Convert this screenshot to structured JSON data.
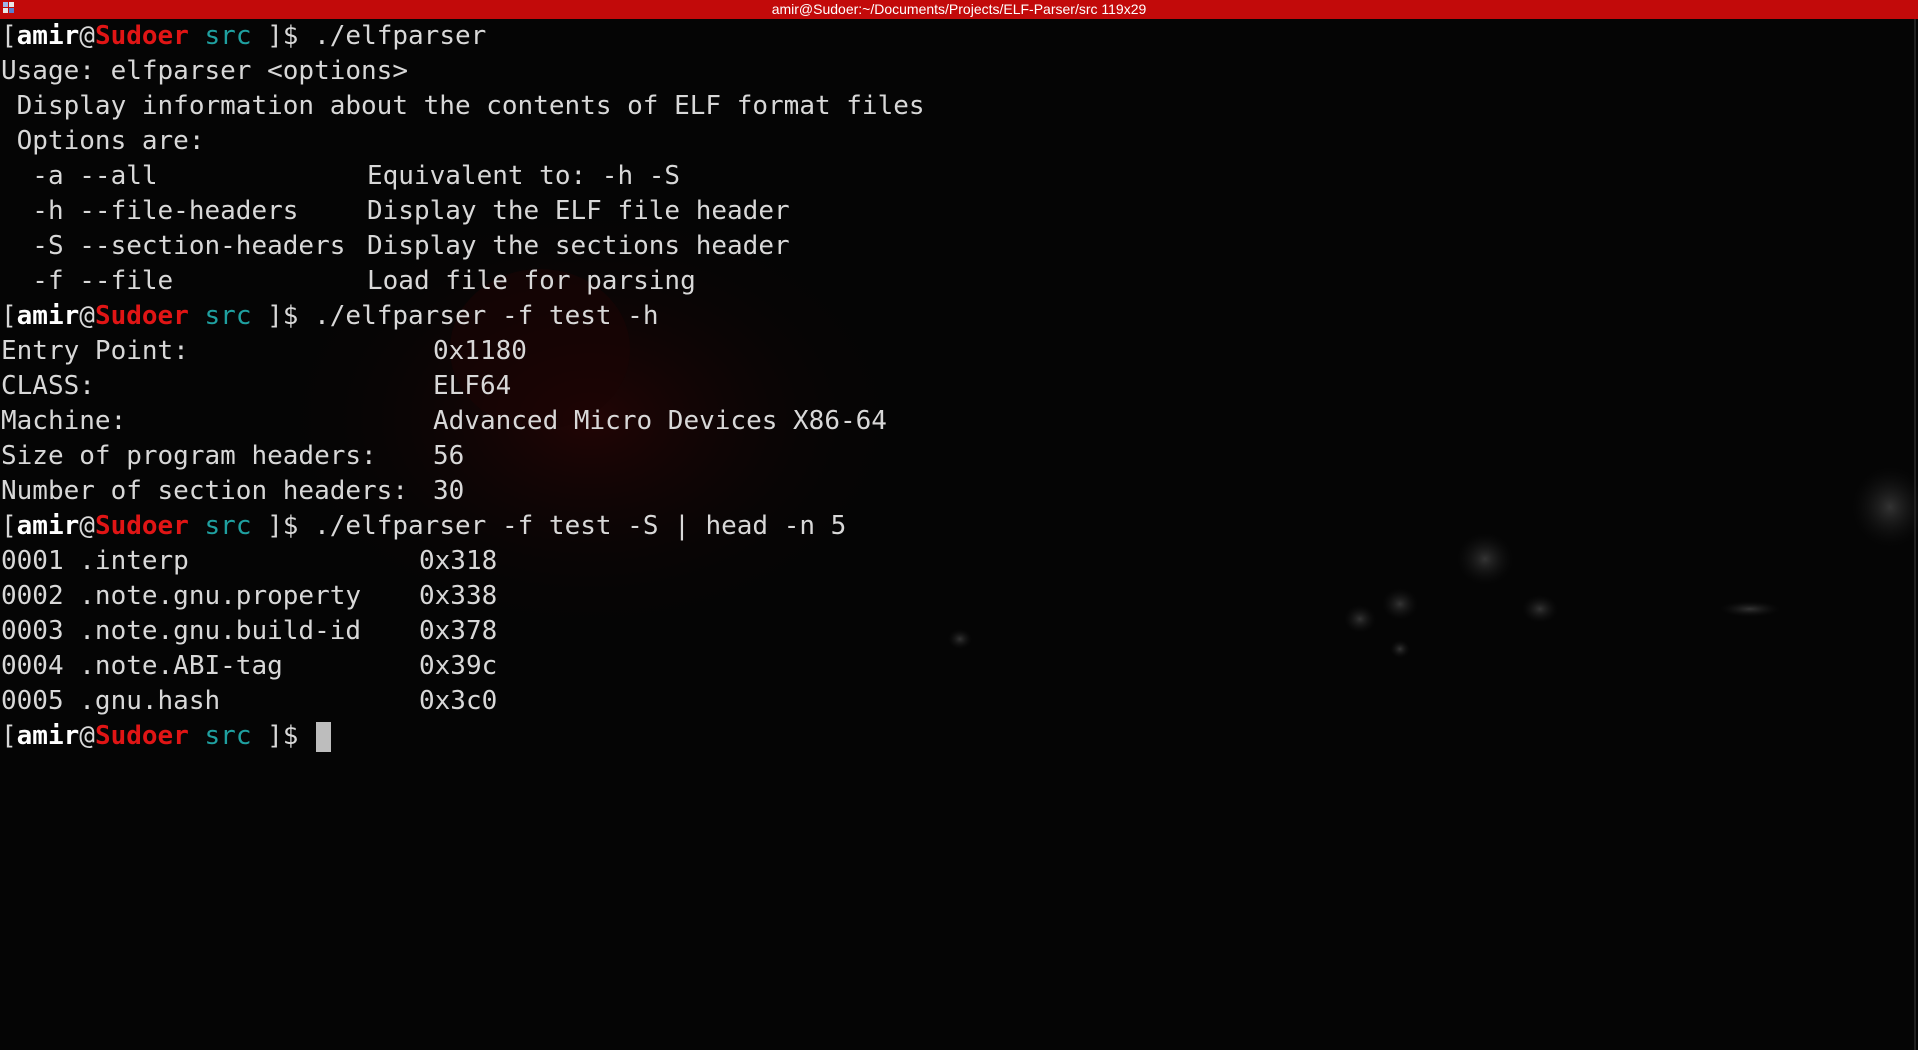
{
  "window": {
    "title": "amir@Sudoer:~/Documents/Projects/ELF-Parser/src 119x29",
    "colors": {
      "titlebar": "#c20a0a",
      "background": "#050505",
      "host": "#e01515",
      "dir": "#1fa0a0"
    }
  },
  "prompt": {
    "open": "[",
    "user": "amir",
    "at": "@",
    "host": "Sudoer",
    "dir": "src",
    "close": " ]$"
  },
  "session": {
    "cmd1": "./elfparser",
    "usage": "Usage: elfparser <options>",
    "description": " Display information about the contents of ELF format files",
    "options_header": " Options are:",
    "options": [
      {
        "flag": "  -a --all",
        "desc": "Equivalent to: -h -S"
      },
      {
        "flag": "  -h --file-headers",
        "desc": "Display the ELF file header"
      },
      {
        "flag": "  -S --section-headers",
        "desc": "Display the sections header"
      },
      {
        "flag": "  -f --file",
        "desc": "Load file for parsing"
      }
    ],
    "cmd2": "./elfparser -f test -h",
    "header_fields": [
      {
        "label": "Entry Point:",
        "value": "0x1180"
      },
      {
        "label": "CLASS:",
        "value": "ELF64"
      },
      {
        "label": "Machine:",
        "value": "Advanced Micro Devices X86-64"
      },
      {
        "label": "Size of program headers:",
        "value": "56"
      },
      {
        "label": "Number of section headers:",
        "value": "30"
      }
    ],
    "cmd3": "./elfparser -f test -S | head -n 5",
    "sections": [
      {
        "name": "0001 .interp",
        "addr": "0x318"
      },
      {
        "name": "0002 .note.gnu.property",
        "addr": "0x338"
      },
      {
        "name": "0003 .note.gnu.build-id",
        "addr": "0x378"
      },
      {
        "name": "0004 .note.ABI-tag",
        "addr": "0x39c"
      },
      {
        "name": "0005 .gnu.hash",
        "addr": "0x3c0"
      }
    ]
  }
}
